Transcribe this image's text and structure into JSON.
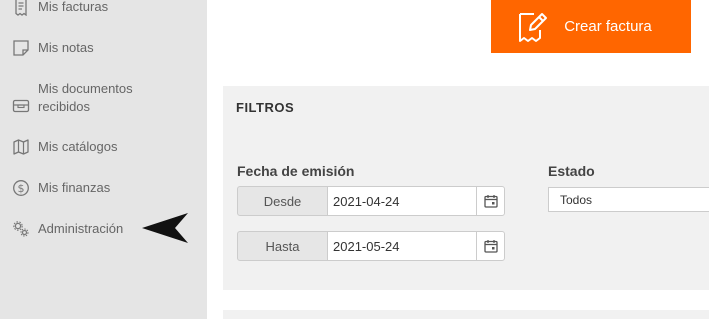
{
  "sidebar": {
    "items": [
      {
        "label": "Mis facturas",
        "icon": "invoice-icon"
      },
      {
        "label": "Mis notas",
        "icon": "note-icon"
      },
      {
        "label": "Mis documentos recibidos",
        "icon": "inbox-icon"
      },
      {
        "label": "Mis catálogos",
        "icon": "map-icon"
      },
      {
        "label": "Mis finanzas",
        "icon": "dollar-coin-icon"
      },
      {
        "label": "Administración",
        "icon": "gears-icon"
      }
    ]
  },
  "header": {
    "create_button": {
      "label": "Crear factura",
      "icon": "edit-document-icon",
      "color": "#ff6600"
    }
  },
  "filters": {
    "title": "FILTROS",
    "fecha_emision": {
      "label": "Fecha de emisión",
      "desde": {
        "label": "Desde",
        "value": "2021-04-24"
      },
      "hasta": {
        "label": "Hasta",
        "value": "2021-05-24"
      }
    },
    "estado": {
      "label": "Estado",
      "selected": "Todos"
    }
  },
  "colors": {
    "sidebar_bg": "#e5e5e5",
    "panel_bg": "#f1f1f1",
    "accent": "#ff6600"
  }
}
